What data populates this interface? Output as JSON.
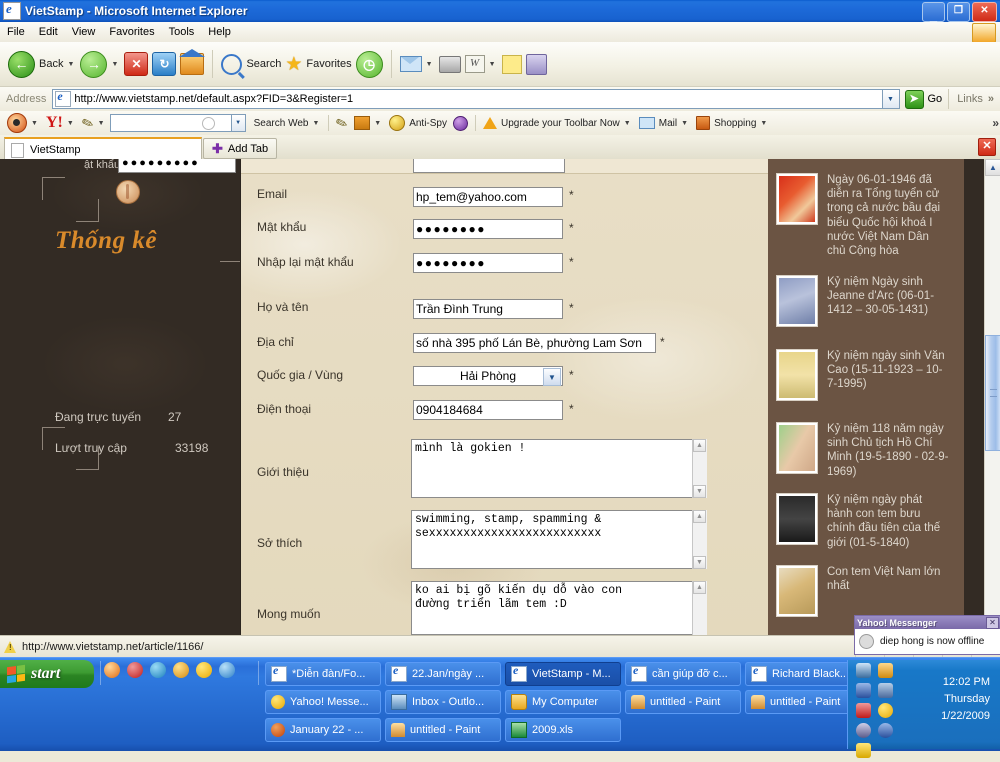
{
  "window": {
    "title": "VietStamp - Microsoft Internet Explorer",
    "icon": "ie-icon",
    "minimize": "_",
    "restore": "❐",
    "close": "✕"
  },
  "menubar": {
    "items": [
      "File",
      "Edit",
      "View",
      "Favorites",
      "Tools",
      "Help"
    ]
  },
  "toolbar": {
    "back": "Back",
    "forward": "",
    "stop": "✕",
    "refresh": "↻",
    "home": "",
    "search": "Search",
    "favorites": "Favorites",
    "history": "",
    "mail": "",
    "print": "",
    "edit": "W",
    "messenger": "",
    "research": "",
    "dropdown_arrow": "▼"
  },
  "address": {
    "label": "Address",
    "url": "http://www.vietstamp.net/default.aspx?FID=3&Register=1",
    "go": "Go",
    "links": "Links",
    "chevron": "»"
  },
  "yahoo_toolbar": {
    "search_placeholder": "",
    "search_value": "",
    "search_web": "Search Web",
    "anti_spy": "Anti-Spy",
    "upgrade": "Upgrade your Toolbar Now",
    "mail": "Mail",
    "shopping": "Shopping",
    "overflow": "»",
    "dropdown_arrow": "▾"
  },
  "tabs": {
    "items": [
      {
        "label": "VietStamp",
        "active": true
      }
    ],
    "add_tab": "Add Tab",
    "close": "✕"
  },
  "page": {
    "cut_row": {
      "label": "ật khẩu",
      "value": "●●●●●●●●●"
    },
    "left_sidebar": {
      "heading": "Thống kê",
      "stats": [
        {
          "label": "Đang trực tuyến",
          "value": "27"
        },
        {
          "label": "Lượt truy cập",
          "value": "33198"
        }
      ]
    },
    "form": {
      "required_mark": "*",
      "fields": [
        {
          "label": "Email",
          "value": "hp_tem@yahoo.com",
          "type": "text",
          "required": true
        },
        {
          "label": "Mật khẩu",
          "value": "●●●●●●●●",
          "type": "password",
          "required": true
        },
        {
          "label": "Nhập lại mật khẩu",
          "value": "●●●●●●●●",
          "type": "password",
          "required": true
        },
        {
          "label": "Họ và tên",
          "value": "Trần Đình Trung",
          "type": "text",
          "required": true
        },
        {
          "label": "Địa chỉ",
          "value": "số nhà 395 phố Lán Bè, phường Lam Sơn",
          "type": "text",
          "required": true
        },
        {
          "label": "Quốc gia / Vùng",
          "value": "Hải Phòng",
          "type": "select",
          "required": true
        },
        {
          "label": "Điện thoại",
          "value": "0904184684",
          "type": "text",
          "required": true
        }
      ],
      "textareas": [
        {
          "label": "Giới thiệu",
          "value": "mình là gokien !"
        },
        {
          "label": "Sở thích",
          "value": "swimming, stamp, spamming &\nsexxxxxxxxxxxxxxxxxxxxxxxxx"
        },
        {
          "label": "Mong muốn",
          "value": "ko ai bị gõ kiến dụ dỗ vào con\nđường triển lãm tem :D"
        }
      ]
    },
    "news_sidebar": {
      "items": [
        {
          "text": "Ngày 06-01-1946 đã diễn ra Tổng tuyển cử trong cả nước bầu đại biểu Quốc hội khoá I nước Việt Nam Dân chủ Cộng hòa",
          "thumb": "stamp-thumb-red"
        },
        {
          "text": "Kỷ niệm Ngày sinh Jeanne d'Arc (06-01-1412 – 30-05-1431)",
          "thumb": "stamp-thumb-blue"
        },
        {
          "text": "Kỷ niệm ngày sinh Văn Cao (15-11-1923 – 10-7-1995)",
          "thumb": "stamp-thumb-yellow"
        },
        {
          "text": "Kỷ niệm 118 năm ngày sinh Chủ tịch Hồ Chí Minh (19-5-1890 - 02-9-1969)",
          "thumb": "stamp-thumb-green"
        },
        {
          "text": "Kỷ niệm ngày phát hành con tem bưu chính đầu tiên của thế giới (01-5-1840)",
          "thumb": "stamp-thumb-black"
        },
        {
          "text": "Con tem Việt Nam lớn nhất",
          "thumb": "stamp-thumb-cream"
        }
      ]
    }
  },
  "toast": {
    "title": "Yahoo! Messenger",
    "close": "✕",
    "message": "diep hong is now offline"
  },
  "statusbar": {
    "text": "http://www.vietstamp.net/article/1166/"
  },
  "taskbar": {
    "start": "start",
    "buttons": [
      {
        "label": "*Diễn đàn/Fo...",
        "icon": "ie-icon",
        "active": false,
        "row": 0,
        "col": 0
      },
      {
        "label": "22.Jan/ngày ...",
        "icon": "ie-icon",
        "active": false,
        "row": 0,
        "col": 1
      },
      {
        "label": "VietStamp - M...",
        "icon": "ie-icon",
        "active": true,
        "row": 0,
        "col": 2
      },
      {
        "label": "cần giúp đỡ c...",
        "icon": "ie-icon",
        "active": false,
        "row": 0,
        "col": 3
      },
      {
        "label": "Richard Black...",
        "icon": "ie-icon",
        "active": false,
        "row": 0,
        "col": 4
      },
      {
        "label": "Yahoo! Messe...",
        "icon": "yahoo-messenger-icon",
        "active": false,
        "row": 1,
        "col": 0
      },
      {
        "label": "Inbox - Outlo...",
        "icon": "outlook-icon",
        "active": false,
        "row": 1,
        "col": 1
      },
      {
        "label": "My Computer",
        "icon": "folder-icon",
        "active": false,
        "row": 1,
        "col": 2
      },
      {
        "label": "untitled - Paint",
        "icon": "paint-icon",
        "active": false,
        "row": 1,
        "col": 3
      },
      {
        "label": "untitled - Paint",
        "icon": "paint-icon",
        "active": false,
        "row": 1,
        "col": 4
      },
      {
        "label": "January 22 - ...",
        "icon": "firefox-icon",
        "active": false,
        "row": 2,
        "col": 0
      },
      {
        "label": "untitled - Paint",
        "icon": "paint-icon",
        "active": false,
        "row": 2,
        "col": 1
      },
      {
        "label": "2009.xls",
        "icon": "excel-icon",
        "active": false,
        "row": 2,
        "col": 2
      }
    ],
    "clock": {
      "time": "12:02 PM",
      "day": "Thursday",
      "date": "1/22/2009"
    }
  }
}
